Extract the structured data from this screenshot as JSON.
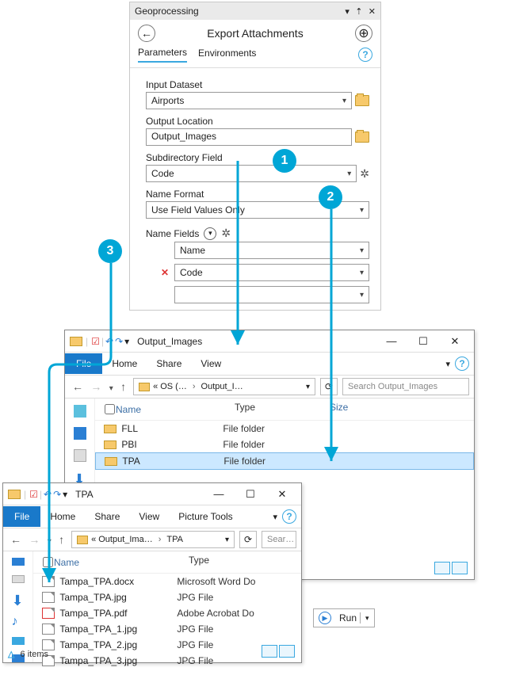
{
  "geo": {
    "pane_title": "Geoprocessing",
    "tool_name": "Export Attachments",
    "tabs": {
      "parameters": "Parameters",
      "environments": "Environments"
    },
    "input_dataset": {
      "label": "Input Dataset",
      "value": "Airports"
    },
    "output_location": {
      "label": "Output Location",
      "value": "Output_Images"
    },
    "subdir_field": {
      "label": "Subdirectory Field",
      "value": "Code"
    },
    "name_format": {
      "label": "Name Format",
      "value": "Use Field Values Only"
    },
    "name_fields": {
      "label": "Name Fields",
      "rows": [
        "Name",
        "Code"
      ]
    },
    "run": "Run"
  },
  "explorer1": {
    "title": "Output_Images",
    "ribbon": {
      "file": "File",
      "home": "Home",
      "share": "Share",
      "view": "View"
    },
    "crumb": {
      "left": "« OS (…",
      "right": "Output_I…"
    },
    "search_placeholder": "Search Output_Images",
    "cols": {
      "name": "Name",
      "type": "Type",
      "size": "Size"
    },
    "rows": [
      {
        "name": "FLL",
        "type": "File folder"
      },
      {
        "name": "PBI",
        "type": "File folder"
      },
      {
        "name": "TPA",
        "type": "File folder"
      }
    ]
  },
  "explorer2": {
    "title": "TPA",
    "ribbon": {
      "file": "File",
      "home": "Home",
      "share": "Share",
      "view": "View",
      "picture": "Picture Tools"
    },
    "crumb": {
      "left": "« Output_Ima…",
      "right": "TPA"
    },
    "search_placeholder": "Sear…",
    "cols": {
      "name": "Name",
      "type": "Type"
    },
    "rows": [
      {
        "name": "Tampa_TPA.docx",
        "type": "Microsoft Word Do"
      },
      {
        "name": "Tampa_TPA.jpg",
        "type": "JPG File"
      },
      {
        "name": "Tampa_TPA.pdf",
        "type": "Adobe Acrobat Do"
      },
      {
        "name": "Tampa_TPA_1.jpg",
        "type": "JPG File"
      },
      {
        "name": "Tampa_TPA_2.jpg",
        "type": "JPG File"
      },
      {
        "name": "Tampa_TPA_3.jpg",
        "type": "JPG File"
      }
    ],
    "status": "6 items"
  },
  "markers": {
    "m1": "1",
    "m2": "2",
    "m3": "3"
  }
}
